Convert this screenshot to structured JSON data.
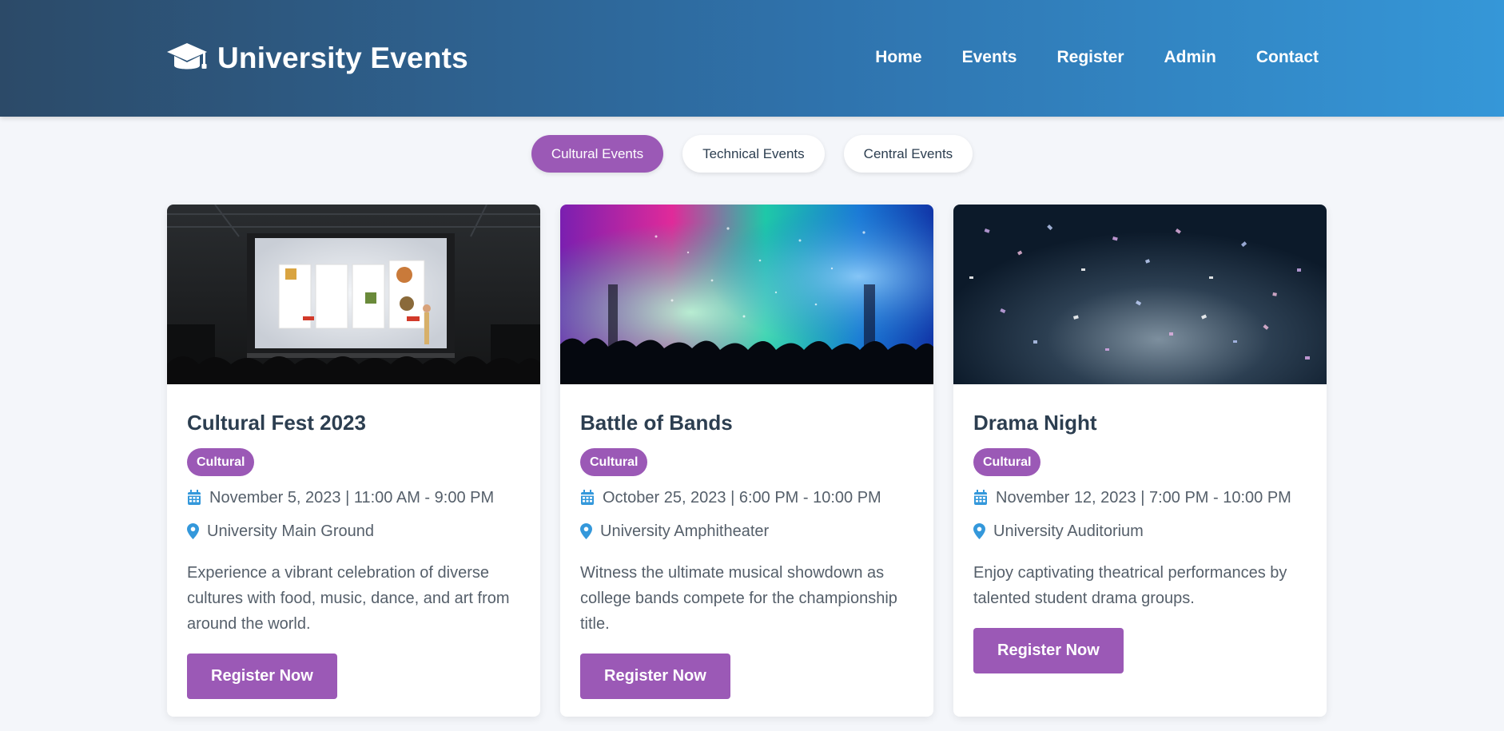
{
  "header": {
    "brand_title": "University Events",
    "brand_icon": "graduation-cap-icon",
    "nav": [
      "Home",
      "Events",
      "Register",
      "Admin",
      "Contact"
    ]
  },
  "tabs": [
    {
      "label": "Cultural Events",
      "active": true
    },
    {
      "label": "Technical Events",
      "active": false
    },
    {
      "label": "Central Events",
      "active": false
    }
  ],
  "cards": [
    {
      "title": "Cultural Fest 2023",
      "badge": "Cultural",
      "datetime": "November 5, 2023 | 11:00 AM - 9:00 PM",
      "location": "University Main Ground",
      "description": "Experience a vibrant celebration of diverse cultures with food, music, dance, and art from around the world.",
      "button": "Register Now"
    },
    {
      "title": "Battle of Bands",
      "badge": "Cultural",
      "datetime": "October 25, 2023 | 6:00 PM - 10:00 PM",
      "location": "University Amphitheater",
      "description": "Witness the ultimate musical showdown as college bands compete for the championship title.",
      "button": "Register Now"
    },
    {
      "title": "Drama Night",
      "badge": "Cultural",
      "datetime": "November 12, 2023 | 7:00 PM - 10:00 PM",
      "location": "University Auditorium",
      "description": "Enjoy captivating theatrical performances by talented student drama groups.",
      "button": "Register Now"
    }
  ],
  "colors": {
    "accent": "#9b59b6",
    "header_start": "#2c4a68",
    "header_end": "#3597d8",
    "icon_blue": "#3498db",
    "text_dark": "#2c3e50"
  }
}
